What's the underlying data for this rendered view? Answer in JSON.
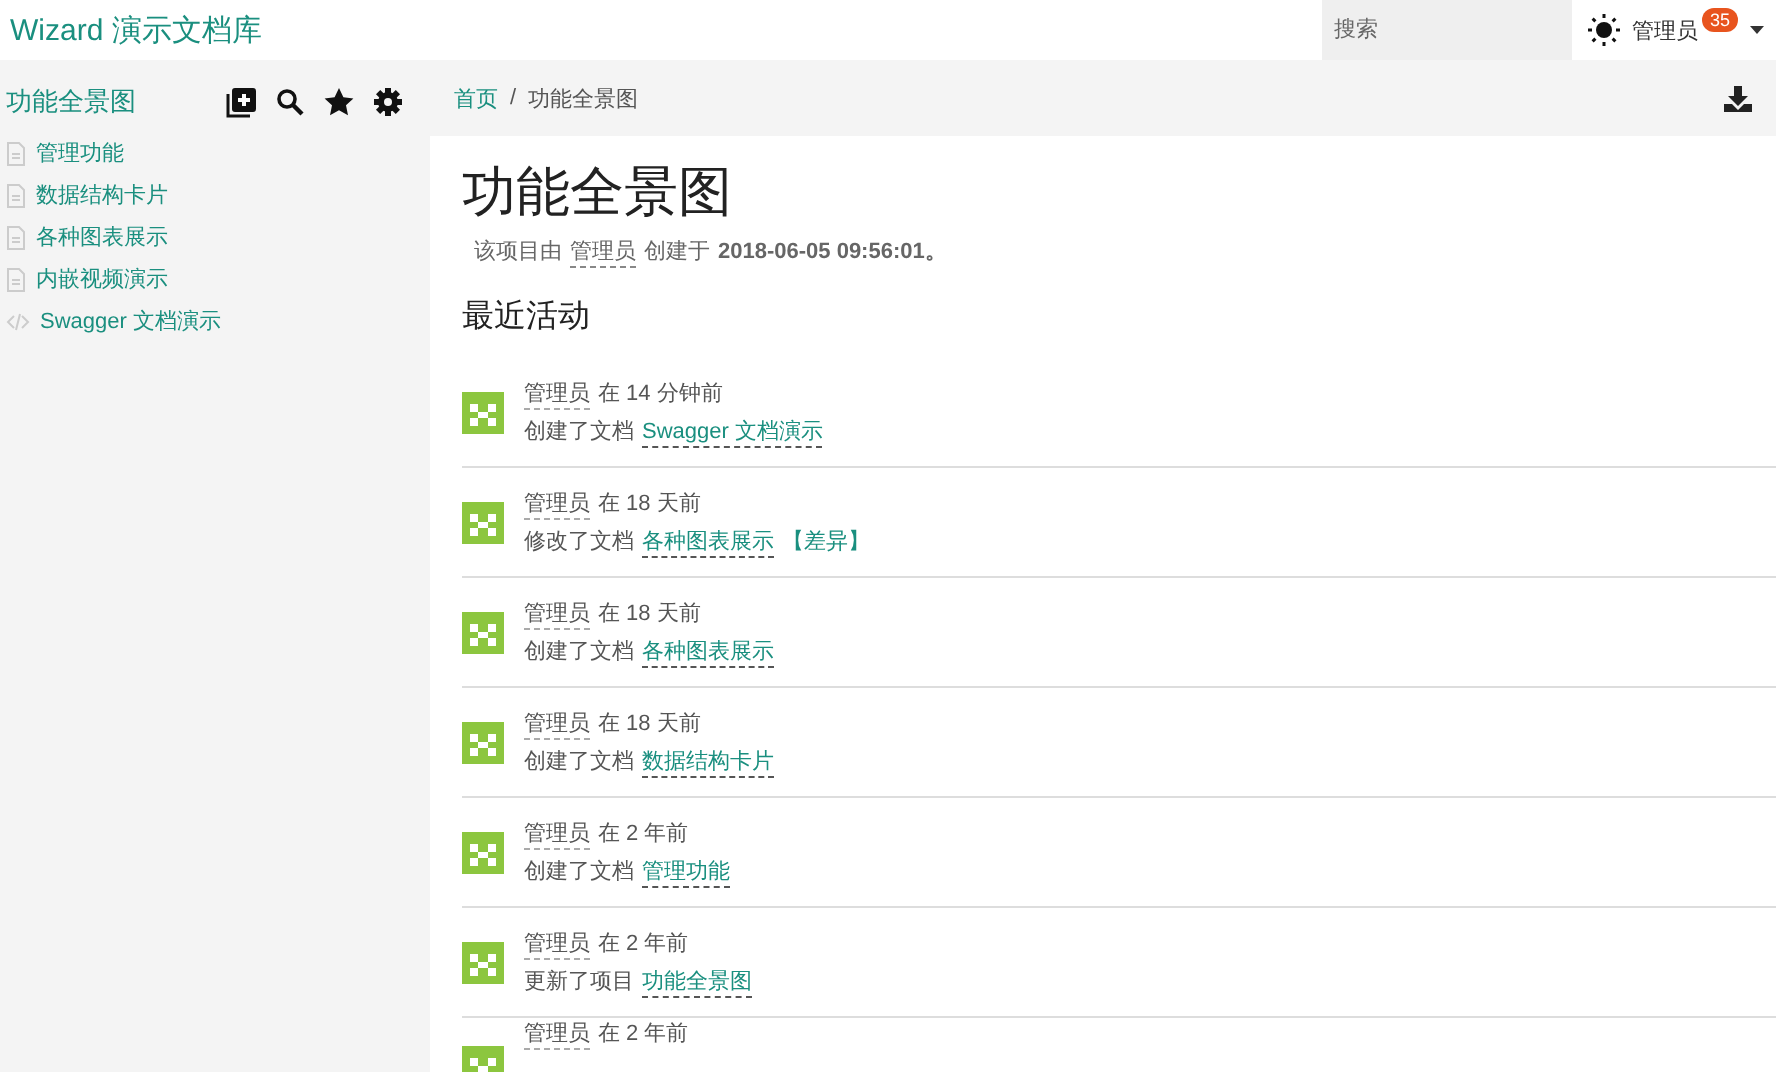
{
  "header": {
    "brand": "Wizard 演示文档库",
    "search": {
      "placeholder": "搜索"
    },
    "user": "管理员",
    "badge": "35"
  },
  "sidebar": {
    "title": "功能全景图",
    "items": [
      {
        "label": "管理功能",
        "kind": "doc"
      },
      {
        "label": "数据结构卡片",
        "kind": "doc"
      },
      {
        "label": "各种图表展示",
        "kind": "doc"
      },
      {
        "label": "内嵌视频演示",
        "kind": "doc"
      },
      {
        "label": "Swagger 文档演示",
        "kind": "code"
      }
    ]
  },
  "breadcrumb": [
    "首页",
    "/",
    "功能全景图"
  ],
  "page": {
    "title": "功能全景图",
    "meta": {
      "prefix": "该项目由",
      "author": "管理员",
      "middle": "创建于",
      "date": "2018-06-05 09:56:01",
      "suffix": "。"
    },
    "section_title": "最近活动"
  },
  "activities": [
    {
      "user": "管理员",
      "time": "在 14 分钟前",
      "action": "创建了文档",
      "target": "Swagger 文档演示"
    },
    {
      "user": "管理员",
      "time": "在 18 天前",
      "action": "修改了文档",
      "target": "各种图表展示",
      "diff": "【差异】"
    },
    {
      "user": "管理员",
      "time": "在 18 天前",
      "action": "创建了文档",
      "target": "各种图表展示"
    },
    {
      "user": "管理员",
      "time": "在 18 天前",
      "action": "创建了文档",
      "target": "数据结构卡片"
    },
    {
      "user": "管理员",
      "time": "在 2 年前",
      "action": "创建了文档",
      "target": "管理功能"
    },
    {
      "user": "管理员",
      "time": "在 2 年前",
      "action": "更新了项目",
      "target": "功能全景图"
    },
    {
      "user": "管理员",
      "time": "在 2 年前"
    }
  ]
}
